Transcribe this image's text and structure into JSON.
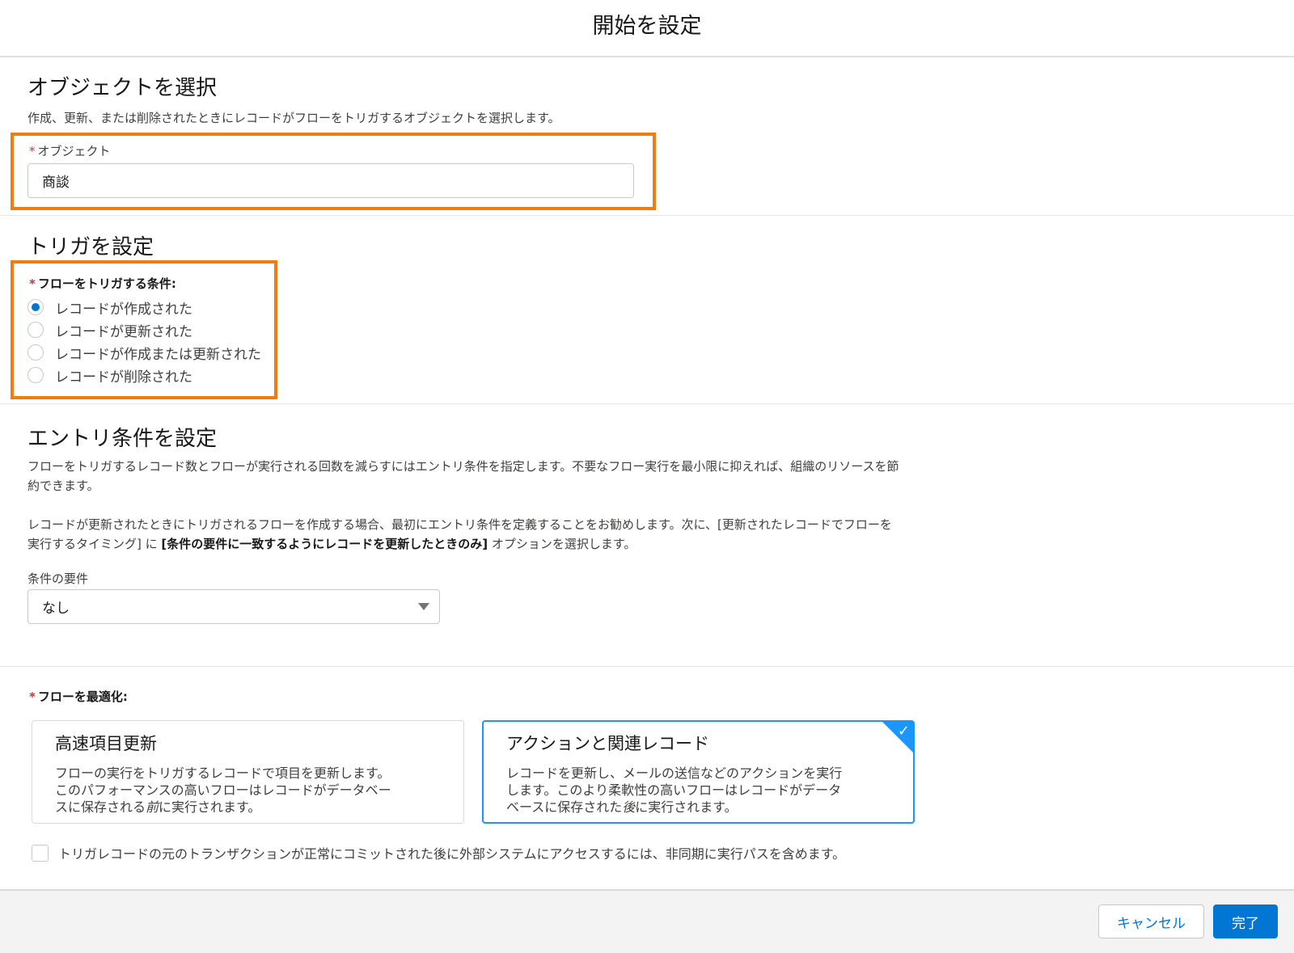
{
  "header": {
    "title": "開始を設定"
  },
  "object_section": {
    "title": "オブジェクトを選択",
    "description": "作成、更新、または削除されたときにレコードがフローをトリガするオブジェクトを選択します。",
    "field_label": "オブジェクト",
    "field_value": "商談"
  },
  "trigger_section": {
    "title": "トリガを設定",
    "group_label": "フローをトリガする条件:",
    "options": [
      {
        "label": "レコードが作成された",
        "checked": true
      },
      {
        "label": "レコードが更新された",
        "checked": false
      },
      {
        "label": "レコードが作成または更新された",
        "checked": false
      },
      {
        "label": "レコードが削除された",
        "checked": false
      }
    ]
  },
  "entry_section": {
    "title": "エントリ条件を設定",
    "para1_line1": "フローをトリガするレコード数とフローが実行される回数を減らすにはエントリ条件を指定します。不要なフロー実行を最小限に抑えれば、組織のリソースを節",
    "para1_line2": "約できます。",
    "para2_line1": "レコードが更新されたときにトリガされるフローを作成する場合、最初にエントリ条件を定義することをお勧めします。次に、[更新されたレコードでフローを",
    "para2_line2_prefix": "実行するタイミング] に ",
    "para2_line2_bold": "[条件の要件に一致するようにレコードを更新したときのみ]",
    "para2_line2_suffix": " オプションを選択します。",
    "condition_label": "条件の要件",
    "condition_value": "なし"
  },
  "optimize_section": {
    "label": "フローを最適化:",
    "cards": [
      {
        "title": "高速項目更新",
        "desc_line1": "フローの実行をトリガするレコードで項目を更新します。",
        "desc_line2": "このパフォーマンスの高いフローはレコードがデータベー",
        "desc_line3_a": "スに保存される",
        "desc_line3_em": "前",
        "desc_line3_b": "に実行されます。",
        "selected": false
      },
      {
        "title": "アクションと関連レコード",
        "desc_line1": "レコードを更新し、メールの送信などのアクションを実行",
        "desc_line2": "します。このより柔軟性の高いフローはレコードがデータ",
        "desc_line3_a": "ベースに保存された",
        "desc_line3_em": "後",
        "desc_line3_b": "に実行されます。",
        "selected": true
      }
    ],
    "async_checkbox_label": "トリガレコードの元のトランザクションが正常にコミットされた後に外部システムにアクセスするには、非同期に実行パスを含めます。",
    "async_checked": false
  },
  "footer": {
    "cancel_label": "キャンセル",
    "done_label": "完了"
  },
  "colors": {
    "highlight": "#f07c13",
    "brand": "#0176d3",
    "selected_border": "#1b96ff",
    "required": "#c23934"
  },
  "icons": {
    "dropdown": "caret-down-icon",
    "selected": "check-icon"
  }
}
